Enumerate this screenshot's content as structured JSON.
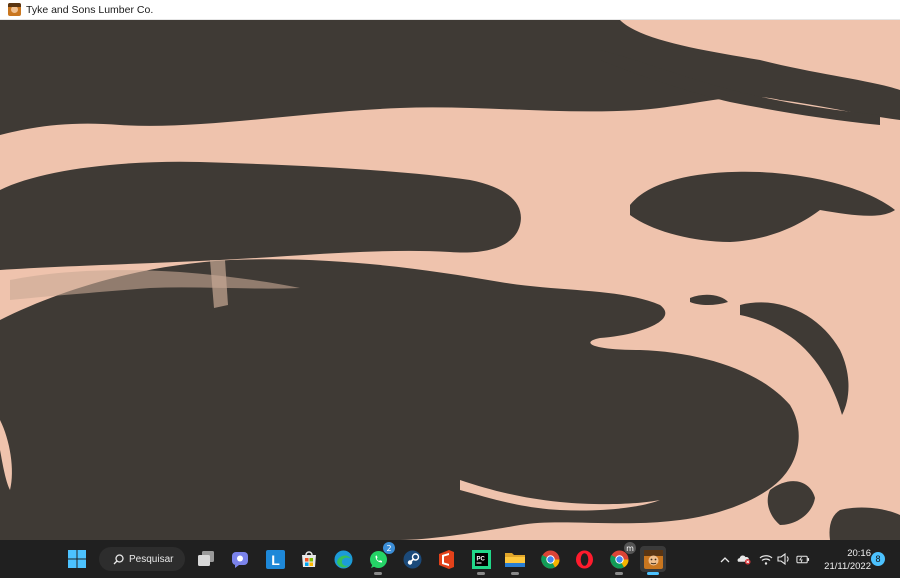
{
  "window": {
    "title": "Tyke and Sons Lumber Co.",
    "icon": "app-icon"
  },
  "canvas": {
    "description_icon": "game-canvas",
    "colors": {
      "skin": "#efc3ad",
      "ink": "#3f3a35"
    }
  },
  "taskbar": {
    "search_label": "Pesquisar",
    "apps": [
      {
        "name": "task-view",
        "icon": "task-view-icon"
      },
      {
        "name": "teams-chat",
        "icon": "teams-chat-icon"
      },
      {
        "name": "l-app",
        "icon": "l-app-icon",
        "glyph": "L"
      },
      {
        "name": "microsoft-store",
        "icon": "store-icon"
      },
      {
        "name": "edge",
        "icon": "edge-icon"
      },
      {
        "name": "whatsapp",
        "icon": "whatsapp-icon",
        "badge": "2"
      },
      {
        "name": "steam",
        "icon": "steam-icon"
      },
      {
        "name": "office",
        "icon": "office-icon"
      },
      {
        "name": "pycharm",
        "icon": "pycharm-icon",
        "glyph": "PC"
      },
      {
        "name": "file-explorer",
        "icon": "folder-icon"
      },
      {
        "name": "chrome",
        "icon": "chrome-icon"
      },
      {
        "name": "opera",
        "icon": "opera-icon"
      },
      {
        "name": "chrome-profile",
        "icon": "chrome-profile-icon",
        "badge": "m"
      },
      {
        "name": "tyke-and-sons",
        "icon": "game-app-icon"
      }
    ],
    "clock": {
      "time": "20:16",
      "date": "21/11/2022"
    },
    "notifications": "8",
    "tray": {
      "chevron": "^",
      "volume": "🔊"
    }
  }
}
